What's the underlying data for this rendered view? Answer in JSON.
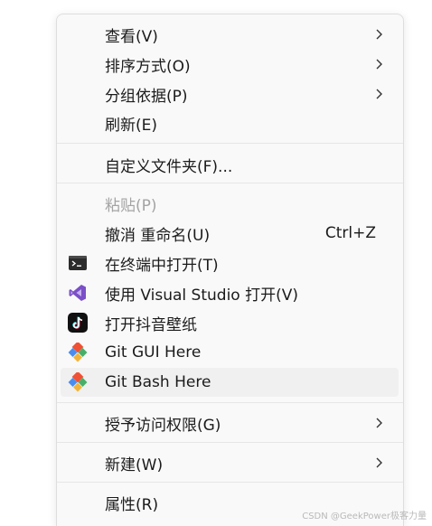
{
  "menu": {
    "items": [
      {
        "label": "查看(V)",
        "submenu": true
      },
      {
        "label": "排序方式(O)",
        "submenu": true
      },
      {
        "label": "分组依据(P)",
        "submenu": true
      },
      {
        "label": "刷新(E)"
      },
      {
        "label": "自定义文件夹(F)..."
      },
      {
        "label": "粘贴(P)",
        "disabled": true
      },
      {
        "label": "撤消 重命名(U)",
        "shortcut": "Ctrl+Z"
      },
      {
        "label": "在终端中打开(T)",
        "icon": "terminal-icon"
      },
      {
        "label": "使用 Visual Studio 打开(V)",
        "icon": "visual-studio-icon"
      },
      {
        "label": "打开抖音壁纸",
        "icon": "douyin-icon"
      },
      {
        "label": "Git GUI Here",
        "icon": "git-icon"
      },
      {
        "label": "Git Bash Here",
        "icon": "git-icon",
        "hover": true
      },
      {
        "label": "授予访问权限(G)",
        "submenu": true
      },
      {
        "label": "新建(W)",
        "submenu": true
      },
      {
        "label": "属性(R)"
      }
    ]
  },
  "watermark": "CSDN @GeekPower极客力量",
  "colors": {
    "vs_purple": "#7a4fc7",
    "git_orange": "#f05033",
    "git_green": "#46b068",
    "git_blue": "#4a8df0",
    "hover_bg": "#f0f0f0"
  }
}
